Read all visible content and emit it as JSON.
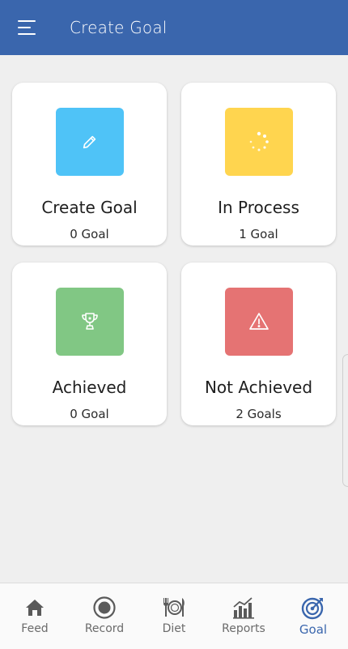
{
  "header": {
    "title": "Create Goal",
    "menu_icon": "hamburger-menu-icon"
  },
  "cards": [
    {
      "title": "Create Goal",
      "count": "0 Goal",
      "color": "#4fc3f7",
      "icon": "pencil-icon"
    },
    {
      "title": "In Process",
      "count": "1 Goal",
      "color": "#ffd54f",
      "icon": "loading-spinner-icon"
    },
    {
      "title": "Achieved",
      "count": "0 Goal",
      "color": "#81c784",
      "icon": "trophy-icon"
    },
    {
      "title": "Not Achieved",
      "count": "2 Goals",
      "color": "#e57373",
      "icon": "warning-icon"
    }
  ],
  "bottom_nav": {
    "active": "Goal",
    "items": [
      {
        "label": "Feed",
        "icon": "home-icon"
      },
      {
        "label": "Record",
        "icon": "record-icon"
      },
      {
        "label": "Diet",
        "icon": "diet-icon"
      },
      {
        "label": "Reports",
        "icon": "reports-icon"
      },
      {
        "label": "Goal",
        "icon": "target-icon"
      }
    ]
  },
  "colors": {
    "primary": "#3a66ad",
    "background": "#efefef",
    "nav_inactive": "#6b6b6b"
  }
}
